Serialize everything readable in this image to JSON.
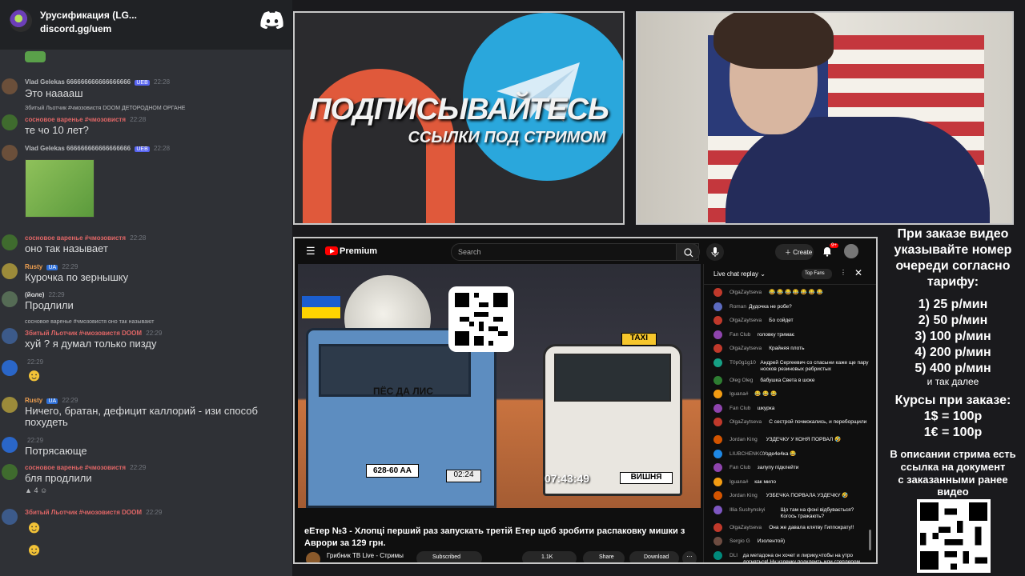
{
  "discord": {
    "server_name": "Урусификация (LG...",
    "invite": "discord.gg/uem",
    "messages": [
      {
        "name": "Vlad Gelekas 666666666666666666",
        "badge": "UEB",
        "time": "22:28",
        "text": "Это нааааш"
      },
      {
        "reply": "Збитый Льотчик #чмозовистя DOOM  ДЕТОРОДНОМ ОРГАНЕ",
        "name": "сосновое варенье #чмозовистя",
        "time": "22:28",
        "text": "те чо 10 лет?"
      },
      {
        "name": "Vlad Gelekas 666666666666666666",
        "badge": "UEB",
        "time": "22:28",
        "text": ""
      },
      {
        "name": "сосновое варенье #чмозовистя",
        "time": "22:28",
        "text": "оно так называет"
      },
      {
        "name": "Rusty",
        "badge": "UA",
        "time": "22:29",
        "text": "Курочка по зернышку"
      },
      {
        "name": "(йоле)",
        "time": "22:29",
        "text": "Продлили"
      },
      {
        "reply": "сосновое варенье #чмозовистя оно так называют",
        "name": "Збитый Льотчик #чмозовистя DOOM",
        "time": "22:29",
        "text": "хуй ? я думал только пизду"
      },
      {
        "name": "",
        "time": "22:29",
        "text": ""
      },
      {
        "name": "Rusty",
        "badge": "UA",
        "time": "22:29",
        "text": "Ничего, братан, дефицит каллорий - изи способ",
        "text2": "похудеть"
      },
      {
        "name": "",
        "time": "22:29",
        "text": "Потрясающе"
      },
      {
        "name": "сосновое варенье #чмозовистя",
        "time": "22:29",
        "text": "бля продлили",
        "reactions": "4"
      },
      {
        "name": "Збитый Льотчик #чмозовистя DOOM",
        "time": "22:29",
        "text": ""
      }
    ]
  },
  "promo": {
    "title": "ПОДПИСЫВАЙТЕСЬ",
    "subtitle": "ССЫЛКИ ПОД СТРИМОМ"
  },
  "youtube": {
    "brand": "Premium",
    "search_placeholder": "Search",
    "create_label": "Create",
    "notif_count": "9+",
    "video": {
      "truck_sign": "ПЁС ДА ЛИС",
      "plate_left": "628-60 AA",
      "time_small": "02:24",
      "taxi": "TAXI",
      "time_big": "07:43:49",
      "plate_right": "ВИШНЯ"
    },
    "title": "еЕтер №3 - Хлопці перший раз запускать третій Етер щоб зробити распаковку мишки з Аврори за 129 грн.",
    "channel": "Грибник ТВ Live - Стримы",
    "subscribed_label": "Subscribed",
    "likes": "1.1K",
    "share_label": "Share",
    "download_label": "Download",
    "chat": {
      "title": "Live chat replay",
      "top_fans": "Top Fans",
      "messages": [
        {
          "name": "OlgaZaytseva",
          "text": "😂 😂 😂 😂 😂 😂 😂",
          "color": "#c0392b"
        },
        {
          "name": "Roman",
          "text": "Дудочка не робе?",
          "color": "#5c6bc0"
        },
        {
          "name": "OlgaZaytseva",
          "text": "Бо сойдет",
          "color": "#c0392b"
        },
        {
          "name": "Fan Club",
          "text": "головку тримає",
          "color": "#8e44ad"
        },
        {
          "name": "OlgaZaytseva",
          "text": "Крайняя плоть",
          "color": "#c0392b"
        },
        {
          "name": "T0p0g1g10",
          "text": "Андрей Сергеевич со спасыни каже ще пару носков резиновых ребристых",
          "color": "#16a085"
        },
        {
          "name": "Oleg Oleg",
          "text": "бабушка Света в шоке",
          "color": "#2e7d32"
        },
        {
          "name": "Iguana#",
          "text": "😂 😂 😂",
          "color": "#f39c12"
        },
        {
          "name": "Fan Club",
          "text": "шкурка",
          "color": "#8e44ad"
        },
        {
          "name": "OlgaZaytseva",
          "text": "С сестрой почмокались, и переборщили",
          "color": "#c0392b"
        },
        {
          "name": "Jordan King",
          "text": "УЗДЕЧКУ У КОНЯ ПОРВАЛ 🤣",
          "color": "#d35400"
        },
        {
          "name": "LIUBCHENKO",
          "text": "Узде4е4ка 😂",
          "color": "#1e88e5"
        },
        {
          "name": "Fan Club",
          "text": "залупу підклейти",
          "color": "#8e44ad"
        },
        {
          "name": "Iguana#",
          "text": "как мило",
          "color": "#f39c12"
        },
        {
          "name": "Jordan King",
          "text": "УЗБЕЧКА ПОРВАЛА УЗДЕЧКУ 🤣",
          "color": "#d35400"
        },
        {
          "name": "Illia Sushynskyi",
          "text": "Що там на фоні відбувається? Когось тражають?",
          "color": "#7e57c2"
        },
        {
          "name": "OlgaZaytseva",
          "text": "Она же давала клятву Гиппократу!!",
          "color": "#c0392b"
        },
        {
          "name": "Sergio G",
          "text": "Изолентой)",
          "color": "#6d4c41"
        },
        {
          "name": "DLI",
          "text": "да метадона он хочет и лирику,чтобы на утро догнаться! Ну уздечку подклеить или степлером накрайняк!",
          "color": "#00897b"
        }
      ]
    }
  },
  "info_panel": {
    "heading": [
      "При заказе видео",
      "указывайте номер",
      "очереди согласно",
      "тарифу:"
    ],
    "tariffs": [
      "1) 25 р/мин",
      "2) 50 р/мин",
      "3) 100 р/мин",
      "4) 200 р/мин",
      "5) 400 р/мин"
    ],
    "etc": "и так далее",
    "rates_heading": "Курсы при заказе:",
    "rates": [
      "1$ = 100р",
      "1€ = 100р"
    ],
    "note": [
      "В описании стрима есть",
      "ссылка на документ",
      "с заказанными ранее",
      "видео"
    ]
  }
}
